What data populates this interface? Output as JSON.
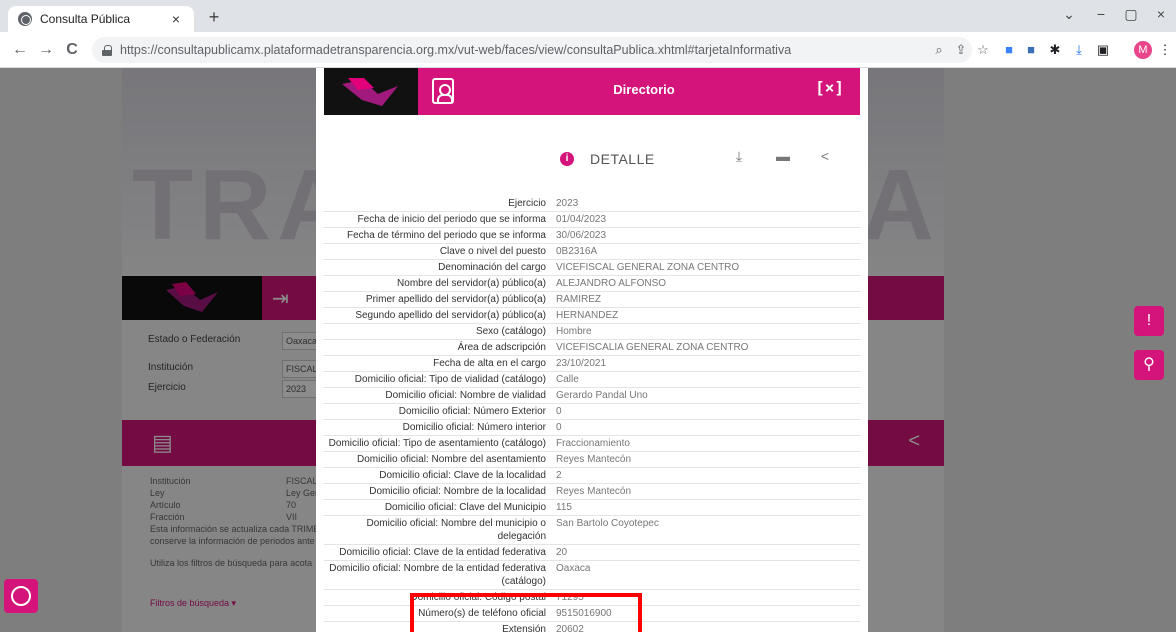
{
  "browser": {
    "tab_title": "Consulta Pública",
    "url": "https://consultapublicamx.plataformadetransparencia.org.mx/vut-web/faces/view/consultaPublica.xhtml#tarjetaInformativa",
    "profile_initial": "M"
  },
  "background": {
    "filters": [
      {
        "label": "Estado o Federación",
        "value": "Oaxaca"
      },
      {
        "label": "Institución",
        "value": "FISCALÍ"
      },
      {
        "label": "Ejercicio",
        "value": "2023"
      }
    ],
    "info_rows": [
      {
        "label": "Institución",
        "value": "FISCALÍ"
      },
      {
        "label": "Ley",
        "value": "Ley Ger"
      },
      {
        "label": "Artículo",
        "value": "70"
      },
      {
        "label": "Fracción",
        "value": "VII"
      }
    ],
    "info_text_1": "Esta información se actualiza cada TRIME",
    "info_text_2": "conserve la información de periodos ante",
    "info_text_3": "Utiliza los filtros de búsqueda para acota",
    "filters_link": "Filtros de búsqueda ▾"
  },
  "modal": {
    "title": "Directorio",
    "close_label": "[×]",
    "detail_label": "DETALLE",
    "rows": [
      {
        "label": "Ejercicio",
        "value": "2023"
      },
      {
        "label": "Fecha de inicio del periodo que se informa",
        "value": "01/04/2023"
      },
      {
        "label": "Fecha de término del periodo que se informa",
        "value": "30/06/2023"
      },
      {
        "label": "Clave o nivel del puesto",
        "value": "0B2316A"
      },
      {
        "label": "Denominación del cargo",
        "value": "VICEFISCAL GENERAL ZONA CENTRO"
      },
      {
        "label": "Nombre del servidor(a) público(a)",
        "value": "ALEJANDRO ALFONSO"
      },
      {
        "label": "Primer apellido del servidor(a) público(a)",
        "value": "RAMIREZ"
      },
      {
        "label": "Segundo apellido del servidor(a) público(a)",
        "value": "HERNANDEZ"
      },
      {
        "label": "Sexo (catálogo)",
        "value": "Hombre"
      },
      {
        "label": "Área de adscripción",
        "value": "VICEFISCALIA GENERAL ZONA CENTRO"
      },
      {
        "label": "Fecha de alta en el cargo",
        "value": "23/10/2021"
      },
      {
        "label": "Domicilio oficial: Tipo de vialidad (catálogo)",
        "value": "Calle"
      },
      {
        "label": "Domicilio oficial: Nombre de vialidad",
        "value": "Gerardo Pandal Uno"
      },
      {
        "label": "Domicilio oficial: Número Exterior",
        "value": "0"
      },
      {
        "label": "Domicilio oficial: Número interior",
        "value": "0"
      },
      {
        "label": "Domicilio oficial: Tipo de asentamiento (catálogo)",
        "value": "Fraccionamiento"
      },
      {
        "label": "Domicilio oficial: Nombre del asentamiento",
        "value": "Reyes Mantecón"
      },
      {
        "label": "Domicilio oficial: Clave de la localidad",
        "value": "2"
      },
      {
        "label": "Domicilio oficial: Nombre de la localidad",
        "value": "Reyes Mantecón"
      },
      {
        "label": "Domicilio oficial: Clave del Municipio",
        "value": "115"
      },
      {
        "label": "Domicilio oficial: Nombre del municipio o delegación",
        "value": "San Bartolo Coyotepec"
      },
      {
        "label": "Domicilio oficial: Clave de la entidad federativa",
        "value": "20"
      },
      {
        "label": "Domicilio oficial: Nombre de la entidad federativa (catálogo)",
        "value": "Oaxaca"
      },
      {
        "label": "Domicilio oficial: Código postal",
        "value": "71295"
      },
      {
        "label": "Número(s) de teléfono oficial",
        "value": "9515016900"
      },
      {
        "label": "Extensión",
        "value": "20602"
      }
    ]
  },
  "icons": {
    "close_tab": "×",
    "new_tab": "+",
    "back": "←",
    "forward": "→",
    "reload": "C",
    "minimize": "−",
    "restore": "▢",
    "close": "×",
    "chevron": "⌄",
    "info": "i",
    "share": "<"
  },
  "colors": {
    "brand": "#d4147a",
    "highlight": "#ff0000"
  }
}
